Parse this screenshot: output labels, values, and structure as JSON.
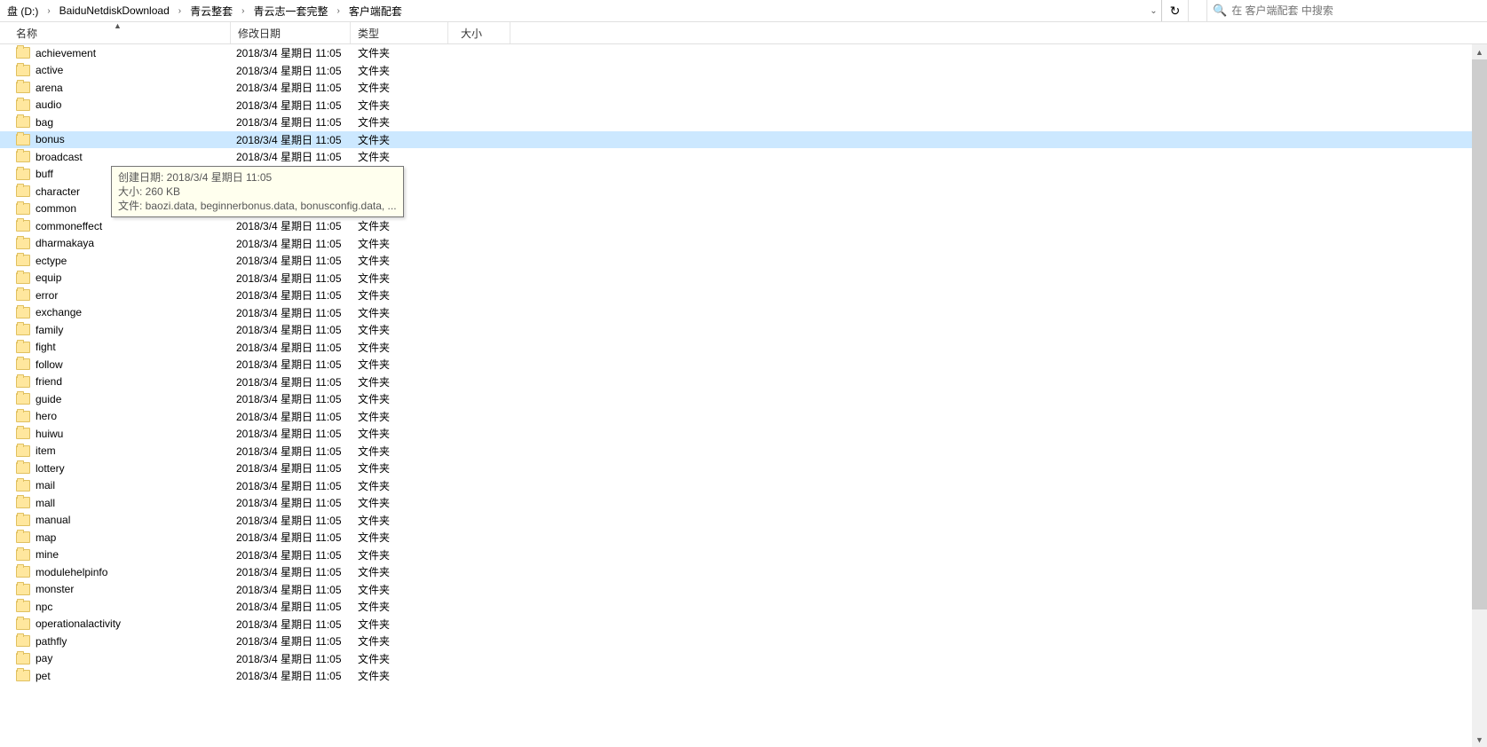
{
  "breadcrumb": {
    "root": "盘 (D:)",
    "items": [
      "BaiduNetdiskDownload",
      "青云整套",
      "青云志一套完整",
      "客户端配套"
    ]
  },
  "search": {
    "placeholder": "在 客户端配套 中搜索"
  },
  "headers": {
    "name": "名称",
    "date": "修改日期",
    "type": "类型",
    "size": "大小"
  },
  "common_date": "2018/3/4 星期日 11:05",
  "common_type": "文件夹",
  "selected_index": 5,
  "tooltip": {
    "line1": "创建日期: 2018/3/4 星期日 11:05",
    "line2": "大小: 260 KB",
    "line3": "文件: baozi.data, beginnerbonus.data, bonusconfig.data, ..."
  },
  "folders": [
    "achievement",
    "active",
    "arena",
    "audio",
    "bag",
    "bonus",
    "broadcast",
    "buff",
    "character",
    "common",
    "commoneffect",
    "dharmakaya",
    "ectype",
    "equip",
    "error",
    "exchange",
    "family",
    "fight",
    "follow",
    "friend",
    "guide",
    "hero",
    "huiwu",
    "item",
    "lottery",
    "mail",
    "mall",
    "manual",
    "map",
    "mine",
    "modulehelpinfo",
    "monster",
    "npc",
    "operationalactivity",
    "pathfly",
    "pay",
    "pet"
  ]
}
